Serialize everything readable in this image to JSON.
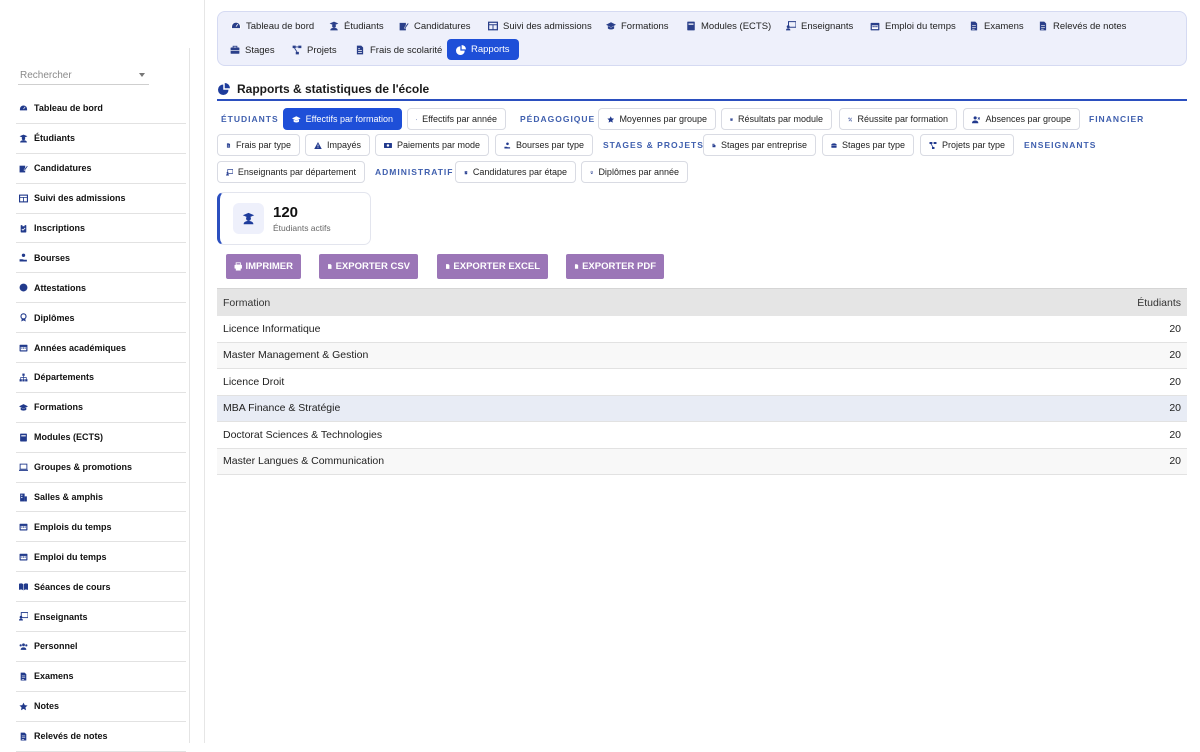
{
  "sidebar": {
    "search_placeholder": "Rechercher",
    "items": [
      {
        "label": "Tableau de bord",
        "icon": "dashboard-icon"
      },
      {
        "label": "Étudiants",
        "icon": "student-icon"
      },
      {
        "label": "Candidatures",
        "icon": "edit-icon"
      },
      {
        "label": "Suivi des admissions",
        "icon": "table-icon"
      },
      {
        "label": "Inscriptions",
        "icon": "clipboard-icon"
      },
      {
        "label": "Bourses",
        "icon": "hand-coin-icon"
      },
      {
        "label": "Attestations",
        "icon": "certificate-icon"
      },
      {
        "label": "Diplômes",
        "icon": "award-icon"
      },
      {
        "label": "Années académiques",
        "icon": "calendar-icon"
      },
      {
        "label": "Départements",
        "icon": "sitemap-icon"
      },
      {
        "label": "Formations",
        "icon": "graduation-cap-icon"
      },
      {
        "label": "Modules (ECTS)",
        "icon": "book-icon"
      },
      {
        "label": "Groupes & promotions",
        "icon": "laptop-icon"
      },
      {
        "label": "Salles & amphis",
        "icon": "building-icon"
      },
      {
        "label": "Emplois du temps",
        "icon": "calendar-icon"
      },
      {
        "label": "Emploi du temps",
        "icon": "calendar-icon"
      },
      {
        "label": "Séances de cours",
        "icon": "open-book-icon"
      },
      {
        "label": "Enseignants",
        "icon": "teacher-icon"
      },
      {
        "label": "Personnel",
        "icon": "users-icon"
      },
      {
        "label": "Examens",
        "icon": "file-icon"
      },
      {
        "label": "Notes",
        "icon": "star-icon"
      },
      {
        "label": "Relevés de notes",
        "icon": "file-icon"
      }
    ]
  },
  "topnav": {
    "items": [
      {
        "label": "Tableau de bord",
        "icon": "dashboard-icon",
        "active": false
      },
      {
        "label": "Étudiants",
        "icon": "student-icon",
        "active": false
      },
      {
        "label": "Candidatures",
        "icon": "edit-icon",
        "active": false
      },
      {
        "label": "Suivi des admissions",
        "icon": "table-icon",
        "active": false
      },
      {
        "label": "Formations",
        "icon": "graduation-cap-icon",
        "active": false
      },
      {
        "label": "Modules (ECTS)",
        "icon": "book-icon",
        "active": false
      },
      {
        "label": "Enseignants",
        "icon": "teacher-icon",
        "active": false
      },
      {
        "label": "Emploi du temps",
        "icon": "calendar-icon",
        "active": false
      },
      {
        "label": "Examens",
        "icon": "file-icon",
        "active": false
      },
      {
        "label": "Relevés de notes",
        "icon": "file-icon",
        "active": false
      },
      {
        "label": "Stages",
        "icon": "briefcase-icon",
        "active": false
      },
      {
        "label": "Projets",
        "icon": "project-diagram-icon",
        "active": false
      },
      {
        "label": "Frais de scolarité",
        "icon": "invoice-icon",
        "active": false
      },
      {
        "label": "Rapports",
        "icon": "pie-chart-icon",
        "active": true
      }
    ]
  },
  "page": {
    "title": "Rapports & statistiques de l'école",
    "title_icon": "pie-chart-icon"
  },
  "report_tabs": [
    {
      "kind": "group",
      "label": "ÉTUDIANTS"
    },
    {
      "kind": "chip",
      "label": "Effectifs par formation",
      "icon": "graduation-cap-icon",
      "active": true
    },
    {
      "kind": "chip",
      "label": "Effectifs par année",
      "icon": "layers-icon"
    },
    {
      "kind": "group",
      "label": "PÉDAGOGIQUE"
    },
    {
      "kind": "chip",
      "label": "Moyennes par groupe",
      "icon": "star-icon"
    },
    {
      "kind": "chip",
      "label": "Résultats par module",
      "icon": "book-icon"
    },
    {
      "kind": "chip",
      "label": "Réussite par formation",
      "icon": "percent-icon"
    },
    {
      "kind": "chip",
      "label": "Absences par groupe",
      "icon": "user-x-icon"
    },
    {
      "kind": "group",
      "label": "FINANCIER"
    },
    {
      "kind": "chip",
      "label": "Frais par type",
      "icon": "invoice-icon"
    },
    {
      "kind": "chip",
      "label": "Impayés",
      "icon": "warning-icon"
    },
    {
      "kind": "chip",
      "label": "Paiements par mode",
      "icon": "money-icon"
    },
    {
      "kind": "chip",
      "label": "Bourses par type",
      "icon": "hand-coin-icon"
    },
    {
      "kind": "group",
      "label": "STAGES & PROJETS"
    },
    {
      "kind": "chip",
      "label": "Stages par entreprise",
      "icon": "building-icon"
    },
    {
      "kind": "chip",
      "label": "Stages par type",
      "icon": "briefcase-icon"
    },
    {
      "kind": "chip",
      "label": "Projets par type",
      "icon": "project-diagram-icon"
    },
    {
      "kind": "group",
      "label": "ENSEIGNANTS"
    },
    {
      "kind": "chip",
      "label": "Enseignants par département",
      "icon": "teacher-icon"
    },
    {
      "kind": "group",
      "label": "ADMINISTRATIF"
    },
    {
      "kind": "chip",
      "label": "Candidatures par étape",
      "icon": "clipboard-icon"
    },
    {
      "kind": "chip",
      "label": "Diplômes par année",
      "icon": "award-icon"
    }
  ],
  "stat": {
    "value": "120",
    "label": "Étudiants actifs",
    "icon": "student-icon"
  },
  "actions": [
    {
      "label": "IMPRIMER",
      "icon": "printer-icon"
    },
    {
      "label": "EXPORTER CSV",
      "icon": "file-icon"
    },
    {
      "label": "EXPORTER EXCEL",
      "icon": "file-icon"
    },
    {
      "label": "EXPORTER PDF",
      "icon": "file-icon"
    }
  ],
  "table": {
    "columns": [
      "Formation",
      "Étudiants"
    ],
    "rows": [
      [
        "Licence Informatique",
        "20"
      ],
      [
        "Master Management & Gestion",
        "20"
      ],
      [
        "Licence Droit",
        "20"
      ],
      [
        "MBA Finance & Stratégie",
        "20"
      ],
      [
        "Doctorat Sciences & Technologies",
        "20"
      ],
      [
        "Master Langues & Communication",
        "20"
      ]
    ],
    "highlighted_row": 3
  },
  "colors": {
    "accent": "#1e4fd8",
    "heading_blue": "#2b4fbf",
    "group_label": "#3f5fae",
    "export_button": "#9b76b7",
    "nav_bg": "#eef0fb"
  }
}
